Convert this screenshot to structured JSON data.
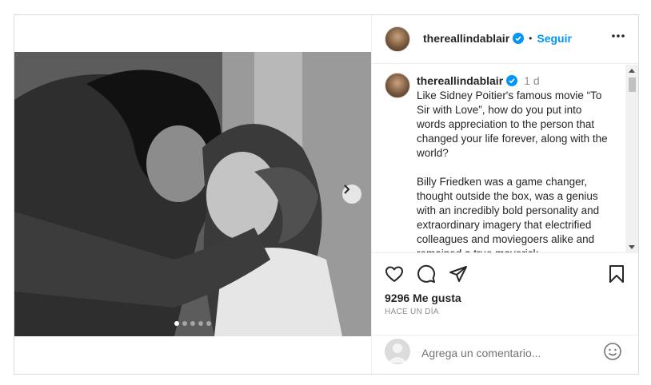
{
  "post": {
    "username": "thereallindablair",
    "follow_label": "Seguir",
    "separator": "•",
    "time_ago": "1 d",
    "caption": "Like Sidney Poitier's famous movie “To Sir with Love”, how do you put into words appreciation to the person that changed your life forever, along with the world?\n\nBilly Friedken was a game changer, thought outside the box, was a genius with an incredibly bold personality and extraordinary imagery that electrified colleagues and moviegoers alike and remained a true maverick",
    "likes": "9296 Me gusta",
    "posted_ago": "HACE UN DÍA"
  },
  "carousel": {
    "count": 5,
    "active_index": 0
  },
  "comment": {
    "placeholder": "Agrega un comentario..."
  },
  "colors": {
    "accent": "#0095f6",
    "text": "#262626",
    "muted": "#8e8e8e",
    "border": "#dbdbdb"
  },
  "icons": [
    "more-icon",
    "verified-badge-icon",
    "carousel-next-icon",
    "heart-icon",
    "comment-icon",
    "share-icon",
    "bookmark-icon",
    "emoji-icon"
  ]
}
